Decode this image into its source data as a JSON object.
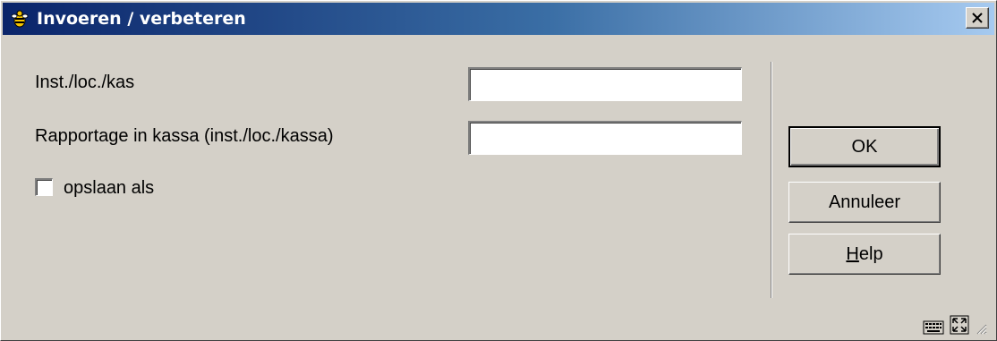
{
  "window": {
    "title": "Invoeren / verbeteren",
    "close_icon": "close-icon"
  },
  "form": {
    "field1_label": "Inst./loc./kas",
    "field1_value": "",
    "field2_label": "Rapportage in kassa (inst./loc./kassa)",
    "field2_value": "",
    "checkbox_label": "opslaan als",
    "checkbox_checked": false
  },
  "buttons": {
    "ok_label": "OK",
    "cancel_label": "Annuleer",
    "help_first": "H",
    "help_rest": "elp"
  },
  "status_icons": [
    "keyboard-icon",
    "maximize-icon",
    "resize-grip-icon"
  ]
}
